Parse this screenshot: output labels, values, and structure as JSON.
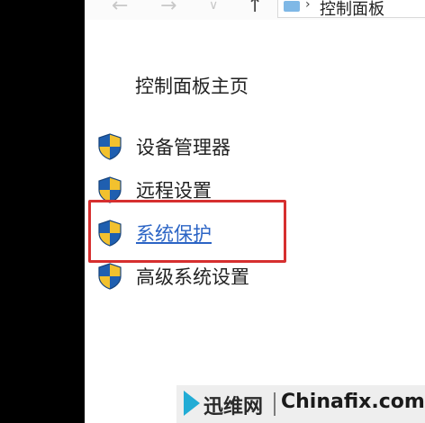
{
  "addressbar": {
    "breadcrumb": "控制面板",
    "separator": "›"
  },
  "nav": {
    "back": "←",
    "forward": "→",
    "dropdown": "∨",
    "up": "↑"
  },
  "sidebar": {
    "home_link": "控制面板主页",
    "items": [
      {
        "label": "设备管理器",
        "icon": "uac-shield-icon"
      },
      {
        "label": "远程设置",
        "icon": "uac-shield-icon"
      },
      {
        "label": "系统保护",
        "icon": "uac-shield-icon",
        "state": "hover-link",
        "highlighted": true
      },
      {
        "label": "高级系统设置",
        "icon": "uac-shield-icon"
      }
    ]
  },
  "highlight_color": "#d62f2f",
  "watermark": {
    "brand": "迅维网",
    "site": "Chinafix.com",
    "accent": "#1aa9d4"
  }
}
